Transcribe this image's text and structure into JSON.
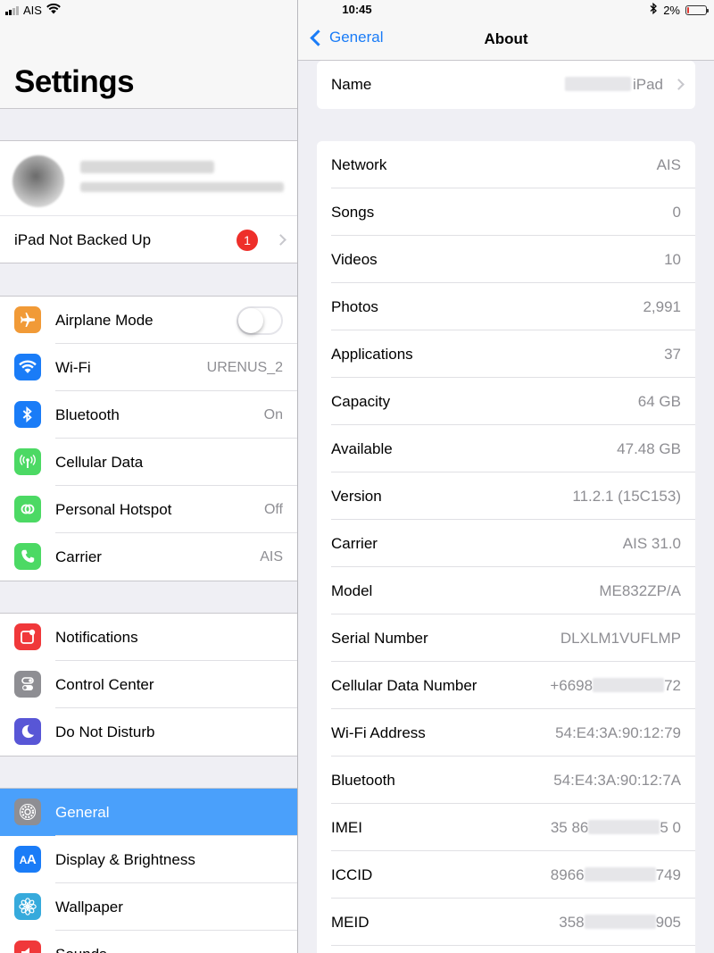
{
  "status_bar": {
    "carrier": "AIS",
    "time": "10:45",
    "battery_percent": "2%",
    "battery_level": 0.02,
    "bluetooth_icon": "bluetooth-icon",
    "wifi_icon": "wifi-icon"
  },
  "sidebar": {
    "title": "Settings",
    "backup_label": "iPad Not Backed Up",
    "backup_badge": "1",
    "groups": [
      [
        {
          "label": "Airplane Mode",
          "icon": "airplane-icon",
          "color": "#f19a37",
          "toggle": false
        },
        {
          "label": "Wi-Fi",
          "icon": "wifi-icon",
          "color": "#1a7cf7",
          "value": "URENUS_2"
        },
        {
          "label": "Bluetooth",
          "icon": "bluetooth-icon",
          "color": "#1a7cf7",
          "value": "On"
        },
        {
          "label": "Cellular Data",
          "icon": "antenna-icon",
          "color": "#4cd964",
          "value": ""
        },
        {
          "label": "Personal Hotspot",
          "icon": "hotspot-icon",
          "color": "#4cd964",
          "value": "Off"
        },
        {
          "label": "Carrier",
          "icon": "phone-icon",
          "color": "#4cd964",
          "value": "AIS"
        }
      ],
      [
        {
          "label": "Notifications",
          "icon": "notifications-icon",
          "color": "#f0383a"
        },
        {
          "label": "Control Center",
          "icon": "control-center-icon",
          "color": "#8e8e93"
        },
        {
          "label": "Do Not Disturb",
          "icon": "moon-icon",
          "color": "#5856d6"
        }
      ],
      [
        {
          "label": "General",
          "icon": "gear-icon",
          "color": "#8e8e93",
          "selected": true
        },
        {
          "label": "Display & Brightness",
          "icon": "text-size-icon",
          "color": "#1a7cf7"
        },
        {
          "label": "Wallpaper",
          "icon": "flower-icon",
          "color": "#36aadc"
        },
        {
          "label": "Sounds",
          "icon": "speaker-icon",
          "color": "#f0383a"
        }
      ]
    ]
  },
  "about": {
    "back_label": "General",
    "title": "About",
    "name_label": "Name",
    "name_value": "iPad",
    "rows": [
      {
        "label": "Network",
        "value": "AIS"
      },
      {
        "label": "Songs",
        "value": "0"
      },
      {
        "label": "Videos",
        "value": "10"
      },
      {
        "label": "Photos",
        "value": "2,991"
      },
      {
        "label": "Applications",
        "value": "37"
      },
      {
        "label": "Capacity",
        "value": "64 GB"
      },
      {
        "label": "Available",
        "value": "47.48 GB"
      },
      {
        "label": "Version",
        "value": "11.2.1 (15C153)"
      },
      {
        "label": "Carrier",
        "value": "AIS 31.0"
      },
      {
        "label": "Model",
        "value": "ME832ZP/A"
      },
      {
        "label": "Serial Number",
        "value": "DLXLM1VUFLMP"
      },
      {
        "label": "Cellular Data Number",
        "value_prefix": "+6698",
        "value_suffix": "72"
      },
      {
        "label": "Wi-Fi Address",
        "value": "54:E4:3A:90:12:79"
      },
      {
        "label": "Bluetooth",
        "value": "54:E4:3A:90:12:7A"
      },
      {
        "label": "IMEI",
        "value_prefix": "35 86",
        "value_suffix": "5 0"
      },
      {
        "label": "ICCID",
        "value_prefix": "8966",
        "value_suffix": "749"
      },
      {
        "label": "MEID",
        "value_prefix": "358",
        "value_suffix": "905"
      }
    ]
  }
}
